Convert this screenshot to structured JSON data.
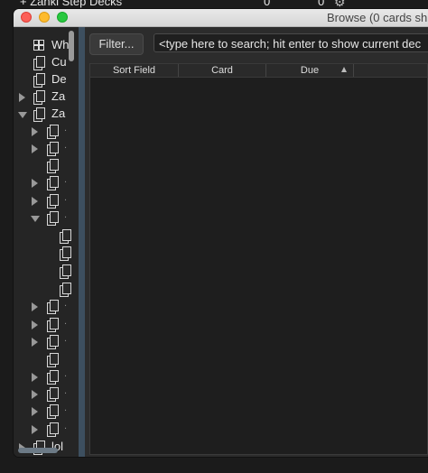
{
  "background": {
    "deck_name": "+ Zanki Step Decks",
    "due_count": "0",
    "new_count": "0"
  },
  "window": {
    "title": "Browse (0 cards sh"
  },
  "sidebar": {
    "items": [
      {
        "label": "Wh",
        "icon": "grid-icon"
      },
      {
        "label": "Cu",
        "icon": "deck-icon"
      },
      {
        "label": "De",
        "icon": "deck-icon"
      },
      {
        "label": "Za",
        "icon": "deck-icon",
        "expander": "collapsed"
      },
      {
        "label": "Za",
        "icon": "deck-icon",
        "expander": "expanded"
      },
      {
        "label": "lol",
        "icon": "deck-icon",
        "expander": "collapsed"
      }
    ]
  },
  "toolbar": {
    "filter_label": "Filter...",
    "search_value": "<type here to search; hit enter to show current dec"
  },
  "table": {
    "columns": [
      "Sort Field",
      "Card",
      "Due"
    ],
    "sort_column": "Due",
    "rows": []
  }
}
